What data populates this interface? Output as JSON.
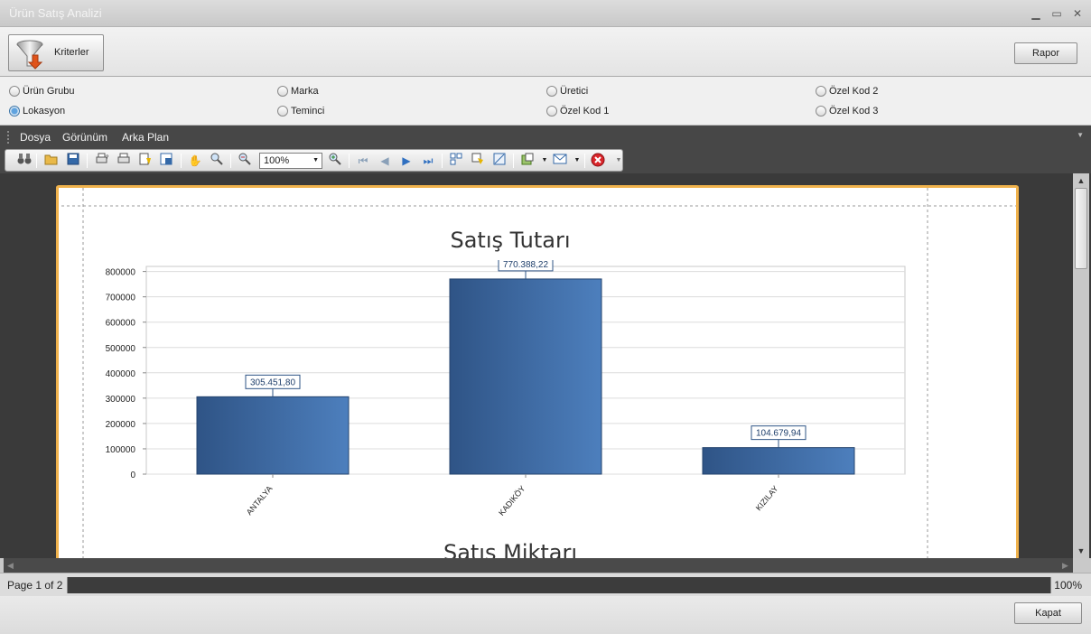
{
  "window": {
    "title": "Ürün Satış Analizi",
    "minimize": "▁",
    "maximize": "▭",
    "close": "✕"
  },
  "topbar": {
    "criteria_label": "Kriterler",
    "report_label": "Rapor"
  },
  "radios": [
    {
      "label": "Ürün Grubu",
      "selected": false
    },
    {
      "label": "Marka",
      "selected": false
    },
    {
      "label": "Üretici",
      "selected": false
    },
    {
      "label": "Özel Kod 2",
      "selected": false
    },
    {
      "label": "Lokasyon",
      "selected": true
    },
    {
      "label": "Teminci",
      "selected": false
    },
    {
      "label": "Özel Kod 1",
      "selected": false
    },
    {
      "label": "Özel Kod 3",
      "selected": false
    }
  ],
  "menu": {
    "file": "Dosya",
    "view": "Görünüm",
    "background": "Arka Plan"
  },
  "toolbar": {
    "zoom_value": "100%"
  },
  "statusbar": {
    "page": "Page 1 of 2",
    "zoom": "100%"
  },
  "bottom": {
    "close_label": "Kapat"
  },
  "colors": {
    "bar_dark": "#2f5486",
    "bar_light": "#4d7fbd",
    "page_border": "#f0b24c"
  },
  "chart_data": [
    {
      "type": "bar",
      "title": "Satış Tutarı",
      "categories": [
        "ANTALYA",
        "KADIKÖY",
        "KIZILAY"
      ],
      "values": [
        305451.8,
        770388.22,
        104679.94
      ],
      "data_labels": [
        "305.451,80",
        "770.388,22",
        "104.679,94"
      ],
      "yticks": [
        "0",
        "100000",
        "200000",
        "300000",
        "400000",
        "500000",
        "600000",
        "700000",
        "800000"
      ],
      "ylim": [
        0,
        820000
      ],
      "grid": true,
      "legend": "none"
    },
    {
      "type": "bar",
      "title": "Satış Miktarı"
    }
  ]
}
